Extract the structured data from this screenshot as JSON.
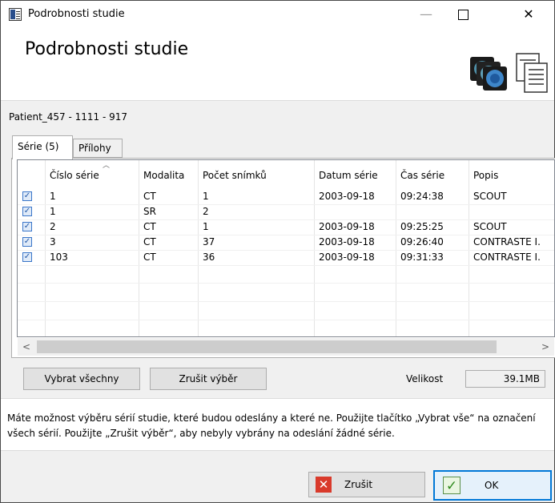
{
  "window": {
    "title": "Podrobnosti studie",
    "controls": {
      "minimize": "—",
      "close": "✕"
    }
  },
  "header": {
    "title": "Podrobnosti studie"
  },
  "patient": "Patient_457 - 1111 - 917",
  "tabs": [
    {
      "label": "Série (5)",
      "active": true
    },
    {
      "label": "Přílohy",
      "active": false
    }
  ],
  "table": {
    "columns": [
      "Číslo série",
      "Modalita",
      "Počet snímků",
      "Datum série",
      "Čas série",
      "Popis"
    ],
    "rows": [
      {
        "checked": true,
        "cells": [
          "1",
          "CT",
          "1",
          "2003-09-18",
          "09:24:38",
          "SCOUT"
        ]
      },
      {
        "checked": true,
        "cells": [
          "1",
          "SR",
          "2",
          "",
          "",
          ""
        ]
      },
      {
        "checked": true,
        "cells": [
          "2",
          "CT",
          "1",
          "2003-09-18",
          "09:25:25",
          "SCOUT"
        ]
      },
      {
        "checked": true,
        "cells": [
          "3",
          "CT",
          "37",
          "2003-09-18",
          "09:26:40",
          "CONTRASTE I."
        ]
      },
      {
        "checked": true,
        "cells": [
          "103",
          "CT",
          "36",
          "2003-09-18",
          "09:31:33",
          "CONTRASTE I."
        ]
      }
    ],
    "scroll_left": "<",
    "scroll_right": ">"
  },
  "buttons": {
    "select_all": "Vybrat všechny",
    "deselect": "Zrušit výběr",
    "cancel": "Zrušit",
    "ok": "OK"
  },
  "size": {
    "label": "Velikost",
    "value": "39.1MB"
  },
  "info_text": "Máte možnost výběru sérií studie, které budou odeslány a které ne. Použijte tlačítko „Vybrat vše“ na označení všech sérií. Použijte „Zrušit výběr“, aby nebyly vybrány na odeslání žádné série.",
  "colors": {
    "accent": "#0078d7",
    "cancel_icon": "#d93a2b",
    "ok_icon": "#2f8a1d"
  },
  "icons": {
    "app": "study-document-icon",
    "header_images": "scan-stack-icon",
    "header_doc": "document-icon",
    "check": "✓",
    "close_x": "✕"
  }
}
